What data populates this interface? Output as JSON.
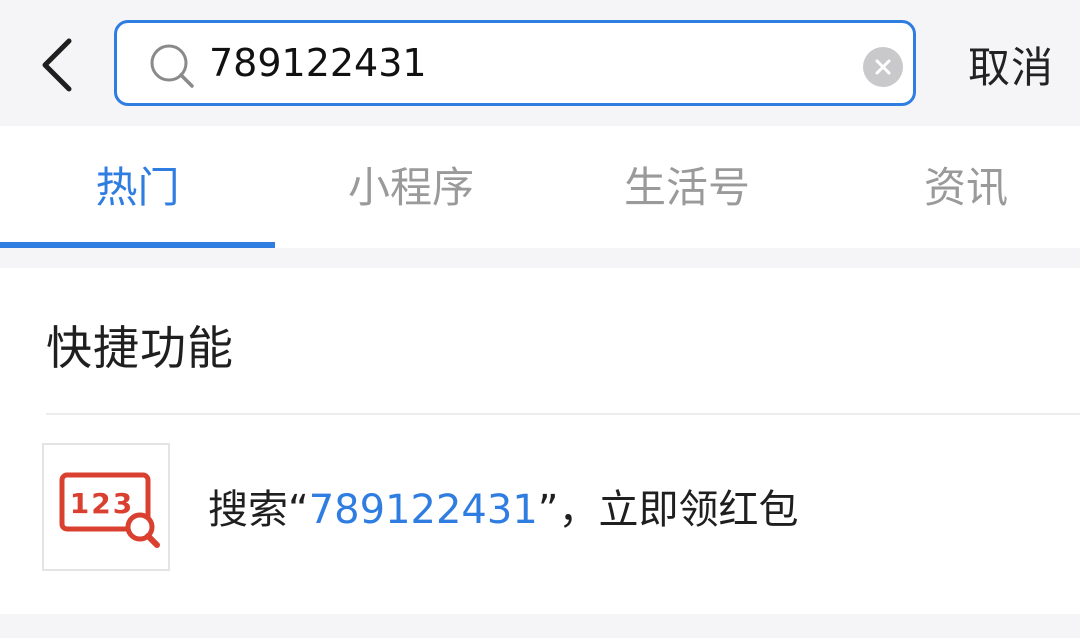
{
  "header": {
    "back_icon": "chevron-left-icon",
    "search": {
      "value": "789122431",
      "placeholder": "",
      "search_icon": "search-icon",
      "clear_icon": "clear-circle-icon"
    },
    "cancel_label": "取消"
  },
  "tabs": [
    {
      "label": "热门",
      "active": true
    },
    {
      "label": "小程序",
      "active": false
    },
    {
      "label": "生活号",
      "active": false
    },
    {
      "label": "资讯",
      "active": false
    }
  ],
  "quick_section": {
    "title": "快捷功能",
    "item": {
      "icon": "number-search-icon",
      "icon_text": "123",
      "prefix": "搜索“",
      "keyword": "789122431",
      "suffix": "”，立即领红包"
    }
  },
  "colors": {
    "accent": "#2f7de1",
    "icon_red": "#d9402f",
    "background": "#f5f5f7"
  }
}
